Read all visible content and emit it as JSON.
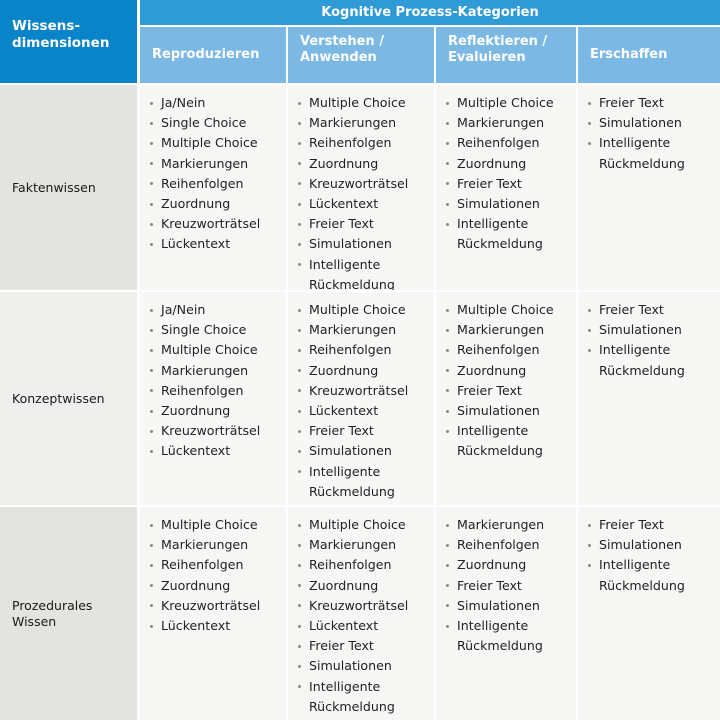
{
  "table": {
    "corner_header": {
      "line1": "Wissens-",
      "line2": "dimensionen"
    },
    "group_header": "Kognitive Prozess-Kategorien",
    "columns": [
      {
        "line1": "Reproduzieren",
        "line2": ""
      },
      {
        "line1": "Verstehen /",
        "line2": "Anwenden"
      },
      {
        "line1": "Reflektieren /",
        "line2": "Evaluieren"
      },
      {
        "line1": "Erschaffen",
        "line2": ""
      }
    ],
    "rows": [
      {
        "label_line1": "Faktenwissen",
        "label_line2": "",
        "cells": [
          [
            "Ja/Nein",
            "Single Choice",
            "Multiple Choice",
            "Markierungen",
            "Reihenfolgen",
            "Zuordnung",
            "Kreuzworträtsel",
            "Lückentext"
          ],
          [
            "Multiple Choice",
            "Markierungen",
            "Reihenfolgen",
            "Zuordnung",
            "Kreuzworträtsel",
            "Lückentext",
            "Freier Text",
            "Simulationen",
            "Intelligente Rückmeldung"
          ],
          [
            "Multiple Choice",
            "Markierungen",
            "Reihenfolgen",
            "Zuordnung",
            "Freier Text",
            "Simulationen",
            "Intelligente Rückmeldung"
          ],
          [
            "Freier Text",
            "Simulationen",
            "Intelligente Rückmeldung"
          ]
        ]
      },
      {
        "label_line1": "Konzeptwissen",
        "label_line2": "",
        "cells": [
          [
            "Ja/Nein",
            "Single Choice",
            "Multiple Choice",
            "Markierungen",
            "Reihenfolgen",
            "Zuordnung",
            "Kreuzworträtsel",
            "Lückentext"
          ],
          [
            "Multiple Choice",
            "Markierungen",
            "Reihenfolgen",
            "Zuordnung",
            "Kreuzworträtsel",
            "Lückentext",
            "Freier Text",
            "Simulationen",
            "Intelligente Rückmeldung"
          ],
          [
            "Multiple Choice",
            "Markierungen",
            "Reihenfolgen",
            "Zuordnung",
            "Freier Text",
            "Simulationen",
            "Intelligente Rückmeldung"
          ],
          [
            "Freier Text",
            "Simulationen",
            "Intelligente Rückmeldung"
          ]
        ]
      },
      {
        "label_line1": "Prozedurales",
        "label_line2": "Wissen",
        "cells": [
          [
            "Multiple Choice",
            "Markierungen",
            "Reihenfolgen",
            "Zuordnung",
            "Kreuzworträtsel",
            "Lückentext"
          ],
          [
            "Multiple Choice",
            "Markierungen",
            "Reihenfolgen",
            "Zuordnung",
            "Kreuzworträtsel",
            "Lückentext",
            "Freier Text",
            "Simulationen",
            "Intelligente Rückmeldung"
          ],
          [
            "Markierungen",
            "Reihenfolgen",
            "Zuordnung",
            "Freier Text",
            "Simulationen",
            "Intelligente Rückmeldung"
          ],
          [
            "Freier Text",
            "Simulationen",
            "Intelligente Rückmeldung"
          ]
        ]
      }
    ]
  },
  "colors": {
    "corner_header_bg": "#0a84c8",
    "group_header_bg": "#2e9ad6",
    "column_header_bg": "#7bb8e4",
    "row_label_bg_dark": "#e3e3e0",
    "row_label_bg_light": "#efefed",
    "cell_bg": "#f6f6f4",
    "bullet": "#8a8a88",
    "text": "#222222",
    "header_text": "#ffffff"
  }
}
